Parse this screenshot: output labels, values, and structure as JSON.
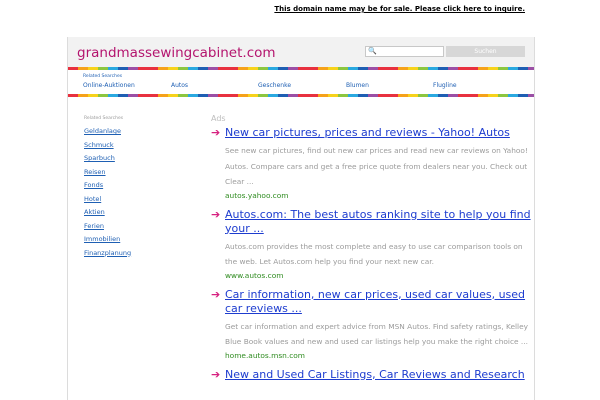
{
  "notice": "This domain name may be for sale. Please click here to inquire.",
  "header": {
    "site": "grandmassewingcabinet.com",
    "search_button": "Suchen"
  },
  "related_bar": {
    "title": "Related Searches",
    "items": [
      "Online-Auktionen",
      "Autos",
      "Geschenke",
      "Blumen",
      "Flugline"
    ]
  },
  "sidebar": {
    "title": "Related Searches",
    "items": [
      "Geldanlage",
      "Schmuck",
      "Sparbuch",
      "Reisen",
      "Fonds",
      "Hotel",
      "Aktien",
      "Ferien",
      "Immobilien",
      "Finanzplanung"
    ]
  },
  "main": {
    "ads_label": "Ads",
    "ads": [
      {
        "title": "New car pictures, prices and reviews - Yahoo! Autos",
        "desc": "See new car pictures, find out new car prices and read new car reviews on Yahoo! Autos. Compare cars and get a free price quote from dealers near you. Check out Clear ...",
        "url": "autos.yahoo.com"
      },
      {
        "title": "Autos.com: The best autos ranking site to help you find your ...",
        "desc": "Autos.com provides the most complete and easy to use car comparison tools on the web. Let Autos.com help you find your next new car.",
        "url": "www.autos.com"
      },
      {
        "title": "Car information, new car prices, used car values, used car reviews ...",
        "desc": "Get car information and expert advice from MSN Autos. Find safety ratings, Kelley Blue Book values and new and used car listings help you make the right choice ...",
        "url": "home.autos.msn.com"
      },
      {
        "title": "New and Used Car Listings, Car Reviews and Research",
        "desc": "",
        "url": ""
      }
    ]
  },
  "colors": {
    "site_title": "#b4146e",
    "link": "#1d3ccf",
    "url": "#2e8b1f",
    "arrow": "#d6217f"
  }
}
